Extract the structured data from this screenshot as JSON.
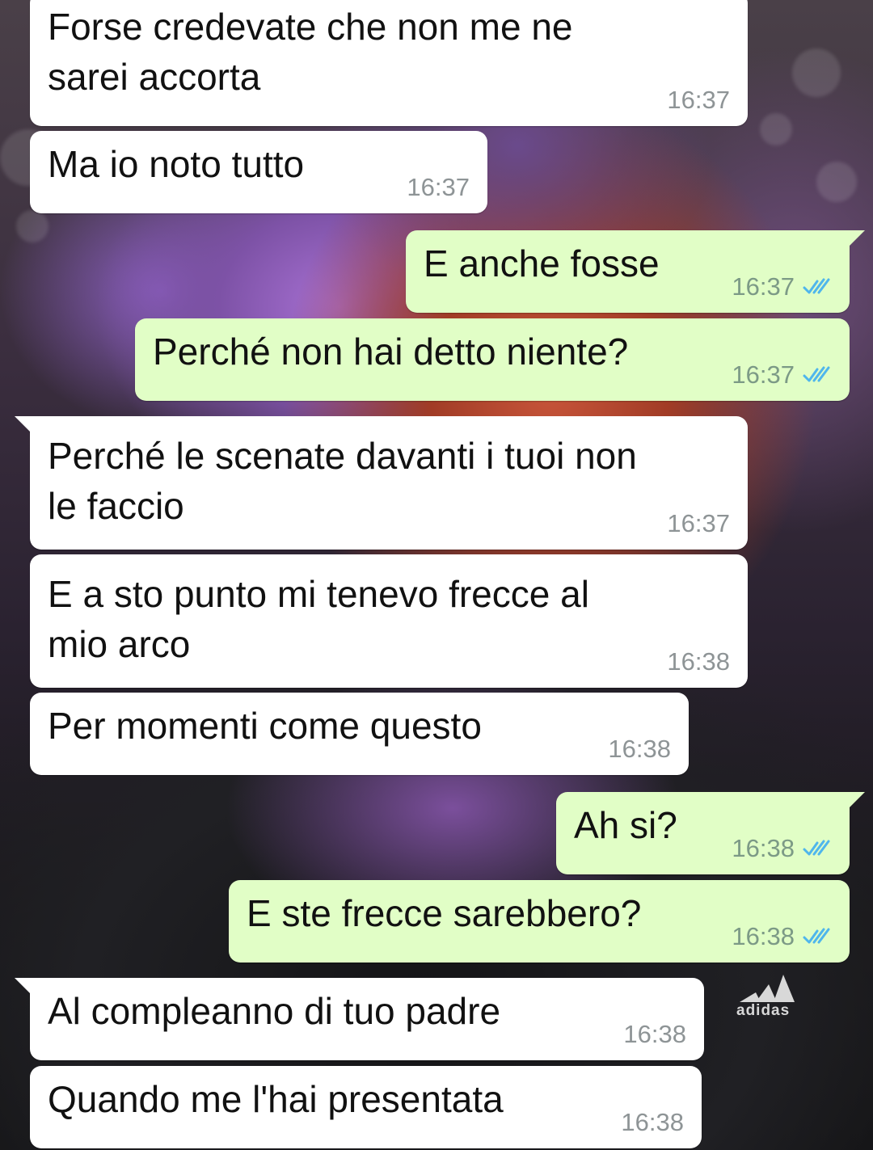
{
  "messages": [
    {
      "direction": "incoming",
      "text": "Forse credevate che non me ne\nsarei accorta",
      "time": "16:37"
    },
    {
      "direction": "incoming",
      "text": "Ma io noto tutto",
      "time": "16:37"
    },
    {
      "direction": "outgoing",
      "text": "E anche fosse",
      "time": "16:37",
      "status": "read-double-check-icon"
    },
    {
      "direction": "outgoing",
      "text": "Perché non hai detto niente?",
      "time": "16:37",
      "status": "read-double-check-icon"
    },
    {
      "direction": "incoming",
      "text": "Perché le scenate davanti i tuoi non\nle faccio",
      "time": "16:37"
    },
    {
      "direction": "incoming",
      "text": "E a sto punto mi tenevo frecce al\nmio arco",
      "time": "16:38"
    },
    {
      "direction": "incoming",
      "text": "Per momenti come questo",
      "time": "16:38"
    },
    {
      "direction": "outgoing",
      "text": "Ah si?",
      "time": "16:38",
      "status": "read-double-check-icon"
    },
    {
      "direction": "outgoing",
      "text": "E ste frecce sarebbero?",
      "time": "16:38",
      "status": "read-double-check-icon"
    },
    {
      "direction": "incoming",
      "text": "Al compleanno di tuo padre",
      "time": "16:38"
    },
    {
      "direction": "incoming",
      "text": "Quando me l'hai presentata",
      "time": "16:38"
    }
  ],
  "wallpaper": {
    "logo_text": "adidas"
  },
  "colors": {
    "incoming_bubble": "#ffffff",
    "outgoing_bubble": "#e1fec6",
    "read_tick": "#4fb6ec",
    "timestamp": "#8e9496"
  }
}
